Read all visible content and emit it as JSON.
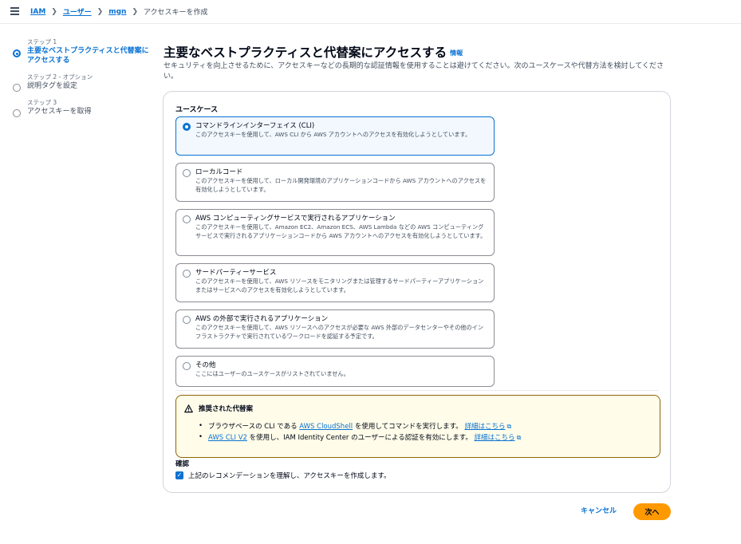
{
  "breadcrumb": {
    "items": [
      "IAM",
      "ユーザー",
      "mgn"
    ],
    "current": "アクセスキーを作成"
  },
  "steps": [
    {
      "num": "ステップ 1",
      "title": "主要なベストプラクティスと代替案にアクセスする",
      "active": true
    },
    {
      "num": "ステップ 2 - オプション",
      "title": "説明タグを設定",
      "active": false
    },
    {
      "num": "ステップ 3",
      "title": "アクセスキーを取得",
      "active": false
    }
  ],
  "page": {
    "title": "主要なベストプラクティスと代替案にアクセスする",
    "info": "情報",
    "description": "セキュリティを向上させるために、アクセスキーなどの長期的な認証情報を使用することは避けてください。次のユースケースや代替方法を検討してください。"
  },
  "usecase": {
    "label": "ユースケース",
    "options": [
      {
        "title": "コマンドラインインターフェイス (CLI)",
        "desc": "このアクセスキーを使用して、AWS CLI から AWS アカウントへのアクセスを有効化しようとしています。",
        "selected": true
      },
      {
        "title": "ローカルコード",
        "desc": "このアクセスキーを使用して、ローカル開発環境のアプリケーションコードから AWS アカウントへのアクセスを有効化しようとしています。",
        "selected": false
      },
      {
        "title": "AWS コンピューティングサービスで実行されるアプリケーション",
        "desc": "このアクセスキーを使用して、Amazon EC2、Amazon ECS、AWS Lambda などの AWS コンピューティングサービスで実行されるアプリケーションコードから AWS アカウントへのアクセスを有効化しようとしています。",
        "selected": false
      },
      {
        "title": "サードパーティーサービス",
        "desc": "このアクセスキーを使用して、AWS リソースをモニタリングまたは管理するサードパーティーアプリケーションまたはサービスへのアクセスを有効化しようとしています。",
        "selected": false
      },
      {
        "title": "AWS の外部で実行されるアプリケーション",
        "desc": "このアクセスキーを使用して、AWS リソースへのアクセスが必要な AWS 外部のデータセンターやその他のインフラストラクチャで実行されているワークロードを認証する予定です。",
        "selected": false
      },
      {
        "title": "その他",
        "desc": "ここにはユーザーのユースケースがリストされていません。",
        "selected": false
      }
    ]
  },
  "alert": {
    "title": "推奨された代替案",
    "item1_pre": "ブラウザベースの CLI である ",
    "item1_link": "AWS CloudShell",
    "item1_post": " を使用してコマンドを実行します。 ",
    "item1_more": "詳細はこちら",
    "item2_link": "AWS CLI V2",
    "item2_post": " を使用し、IAM Identity Center のユーザーによる認証を有効にします。 ",
    "item2_more": "詳細はこちら"
  },
  "confirm": {
    "label": "確認",
    "text": "上記のレコメンデーションを理解し、アクセスキーを作成します。",
    "checked": true
  },
  "buttons": {
    "cancel": "キャンセル",
    "next": "次へ"
  },
  "colors": {
    "accent": "#0972d3",
    "primary_button": "#ff9900",
    "alert_border": "#8d6605",
    "alert_bg": "#fffce9"
  }
}
